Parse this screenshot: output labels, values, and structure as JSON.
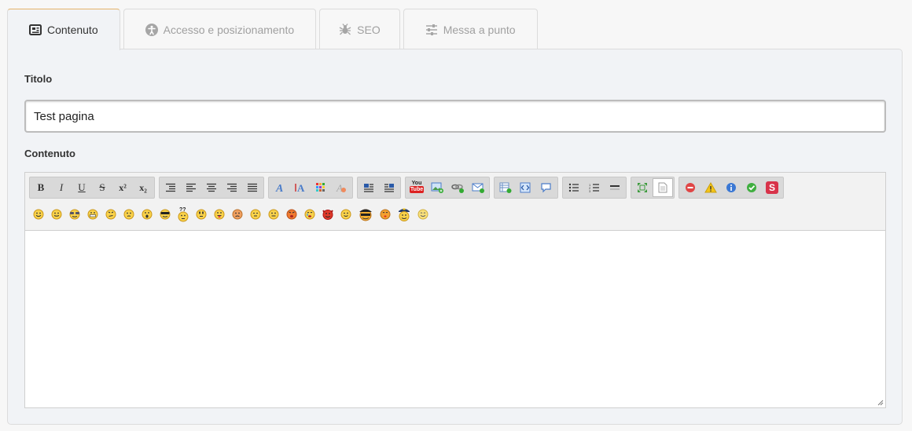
{
  "tabs": [
    {
      "label": "Contenuto",
      "icon": "newspaper-icon"
    },
    {
      "label": "Accesso e posizionamento",
      "icon": "accessibility-icon"
    },
    {
      "label": "SEO",
      "icon": "spider-icon"
    },
    {
      "label": "Messa a punto",
      "icon": "sliders-icon"
    }
  ],
  "form": {
    "title_label": "Titolo",
    "title_value": "Test pagina",
    "content_label": "Contenuto"
  },
  "toolbar": {
    "bold": "B",
    "italic": "I",
    "underline": "U",
    "strike": "S",
    "superscript": "x²",
    "subscript": "x₂",
    "youtube_top": "You",
    "youtube_bottom": "Tube",
    "source_letter": "S"
  },
  "colors": {
    "accent_tab": "#e4b36a",
    "panel_bg": "#f1f3f6"
  }
}
